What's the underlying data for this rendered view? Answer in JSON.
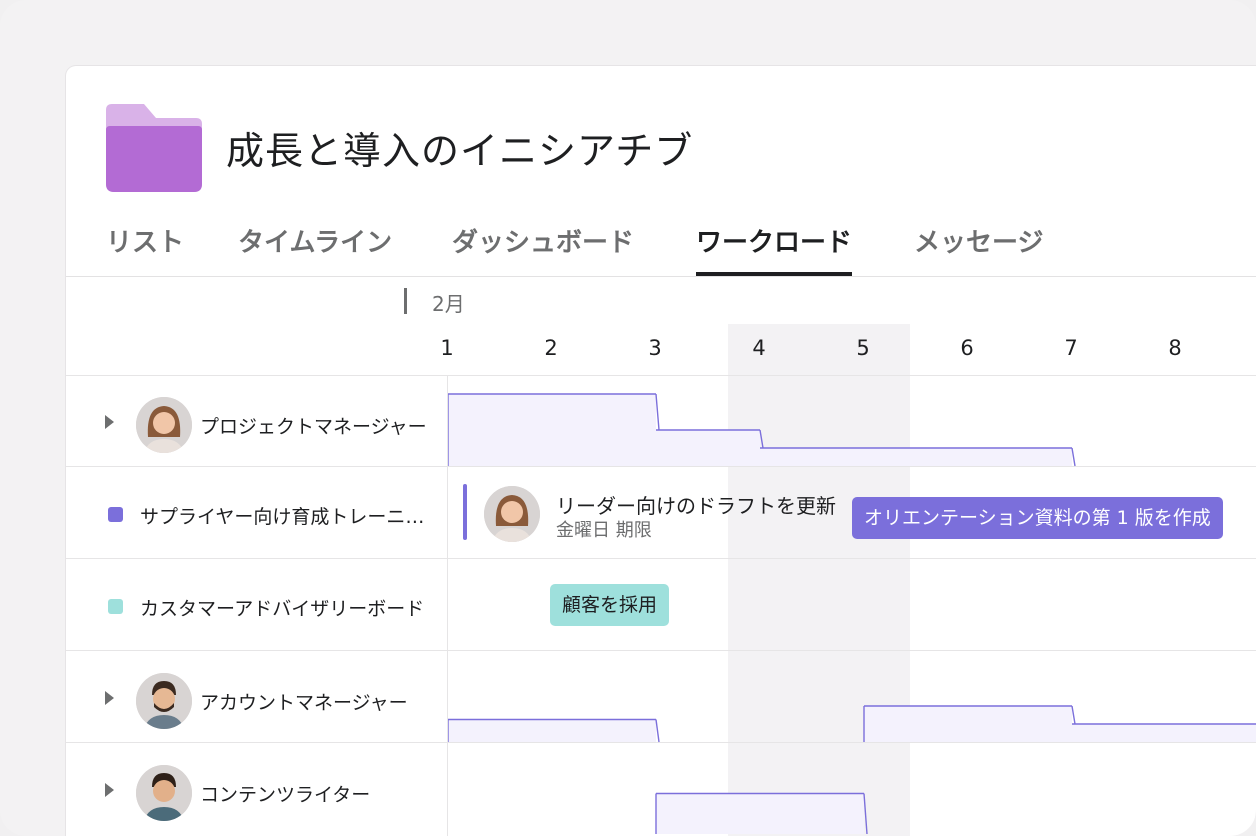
{
  "project": {
    "title": "成長と導入のイニシアチブ",
    "icon": "folder-icon",
    "folder_color": "#b36bd4"
  },
  "tabs": [
    {
      "label": "リスト",
      "active": false
    },
    {
      "label": "タイムライン",
      "active": false
    },
    {
      "label": "ダッシュボード",
      "active": false
    },
    {
      "label": "ワークロード",
      "active": true
    },
    {
      "label": "メッセージ",
      "active": false
    }
  ],
  "timeline": {
    "month": "2月",
    "days": [
      "1",
      "2",
      "3",
      "4",
      "5",
      "6",
      "7",
      "8"
    ],
    "highlighted_days": [
      "4",
      "5"
    ]
  },
  "rows": [
    {
      "label": "プロジェクトマネージャー",
      "type": "person",
      "workload": [
        0.8,
        0.8,
        0.4,
        0.2,
        0.2,
        0.2,
        0.0,
        0.0
      ]
    },
    {
      "label": "サプライヤー向け育成トレーニ…",
      "type": "project",
      "color": "#7b6fdb"
    },
    {
      "label": "カスタマーアドバイザリーボード",
      "type": "project",
      "color": "#9ee0dc"
    },
    {
      "label": "アカウントマネージャー",
      "type": "person",
      "workload": [
        0.25,
        0.25,
        0.0,
        0.0,
        0.4,
        0.4,
        0.2,
        0.2
      ]
    },
    {
      "label": "コンテンツライター",
      "type": "person",
      "workload": [
        0.0,
        0.0,
        0.45,
        0.45,
        0.0,
        0.0,
        0.0,
        0.0
      ]
    }
  ],
  "tasks": {
    "draft": {
      "title": "リーダー向けのドラフトを更新",
      "due": "金曜日 期限"
    },
    "orientation": {
      "label": "オリエンテーション資料の第 1 版を作成",
      "color": "#7b6fdb"
    },
    "customer": {
      "label": "顧客を採用",
      "color": "#9ee0dc"
    }
  },
  "colors": {
    "workload_line": "#7b6fdb",
    "workload_fill": "#f4f2fd"
  }
}
